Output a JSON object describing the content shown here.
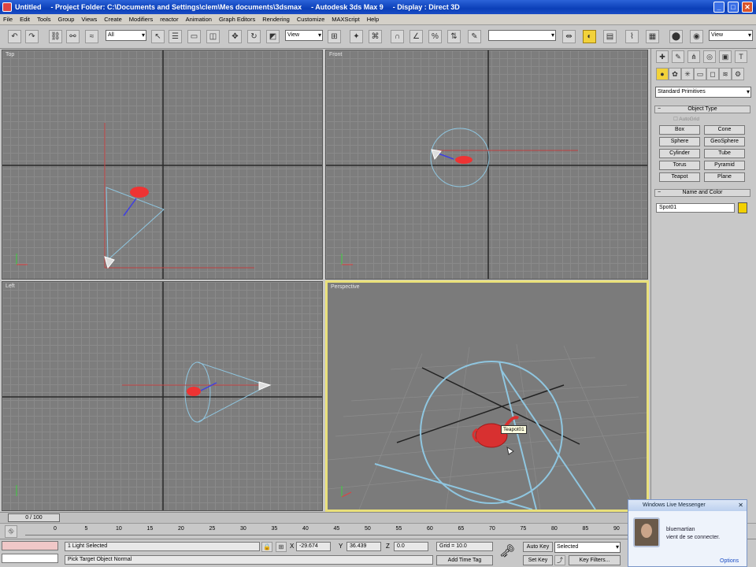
{
  "window": {
    "title_parts": [
      "Untitled",
      "- Project Folder: C:\\Documents and Settings\\clem\\Mes documents\\3dsmax",
      "- Autodesk 3ds Max 9",
      "- Display : Direct 3D"
    ]
  },
  "menu": [
    "File",
    "Edit",
    "Tools",
    "Group",
    "Views",
    "Create",
    "Modifiers",
    "reactor",
    "Animation",
    "Graph Editors",
    "Rendering",
    "Customize",
    "MAXScript",
    "Help"
  ],
  "toolbar": {
    "selection_filter": "All",
    "ref_coord": "View",
    "named_selection": "",
    "view_dropdown": "View"
  },
  "viewports": {
    "top": "Top",
    "front": "Front",
    "left": "Left",
    "perspective": "Perspective",
    "object_tooltip": "Teapot01"
  },
  "command_panel": {
    "category": "Standard Primitives",
    "object_type_title": "Object Type",
    "autogrid": "AutoGrid",
    "primitives": [
      "Box",
      "Cone",
      "Sphere",
      "GeoSphere",
      "Cylinder",
      "Tube",
      "Torus",
      "Pyramid",
      "Teapot",
      "Plane"
    ],
    "name_color_title": "Name and Color",
    "object_name": "Spot01",
    "object_color": "#f2d000"
  },
  "timeline": {
    "frame_display": "0 / 100",
    "ticks": [
      "0",
      "5",
      "10",
      "15",
      "20",
      "25",
      "30",
      "35",
      "40",
      "45",
      "50",
      "55",
      "60",
      "65",
      "70",
      "75",
      "80",
      "85",
      "90",
      "95"
    ]
  },
  "status": {
    "selection": "1 Light Selected",
    "prompt": "Pick Target Object Normal",
    "x_label": "X",
    "x_value": "-29.674",
    "y_label": "Y",
    "y_value": "36.439",
    "z_label": "Z",
    "z_value": "0.0",
    "grid": "Grid = 10.0",
    "add_time_tag": "Add Time Tag",
    "auto_key": "Auto Key",
    "set_key": "Set Key",
    "key_mode": "Selected",
    "key_filters": "Key Filters..."
  },
  "messenger": {
    "title": "Windows Live Messenger",
    "contact": "bluemartian",
    "message": "vient de se connecter.",
    "options": "Options"
  }
}
